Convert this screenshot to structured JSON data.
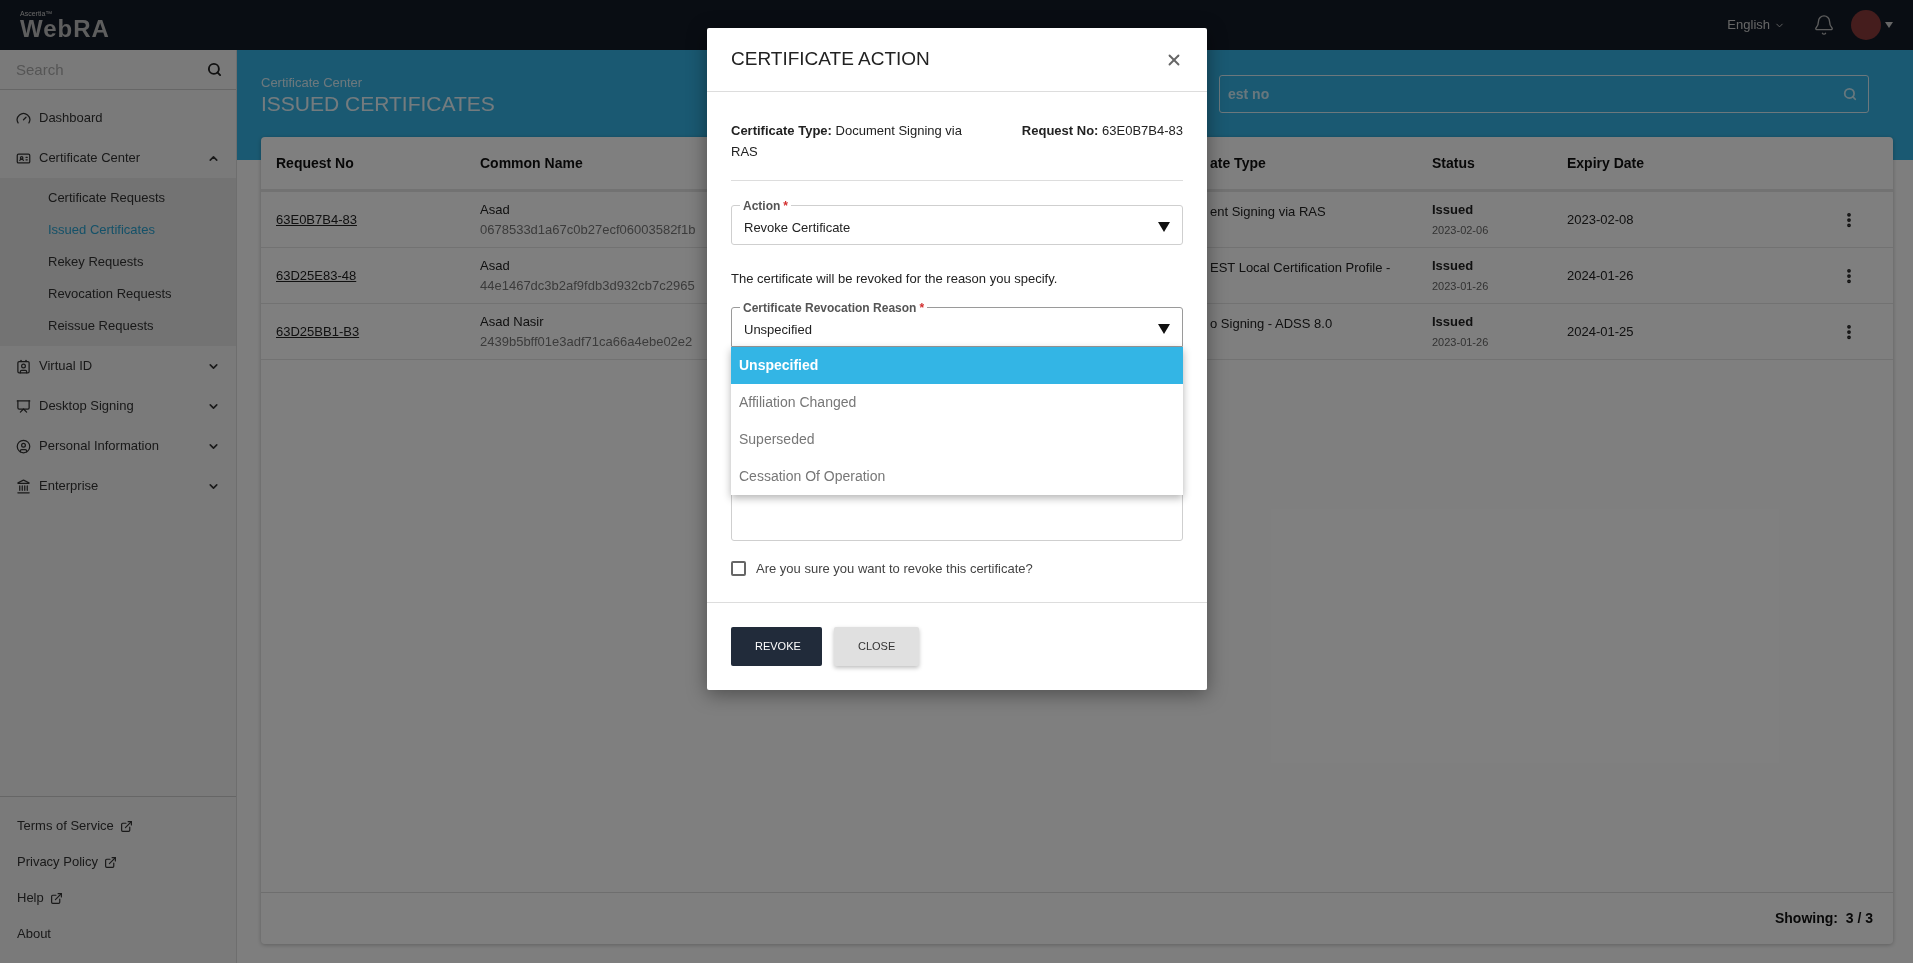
{
  "header": {
    "brand_small": "Ascertia™",
    "brand": "WebRA",
    "language": "English"
  },
  "sidebar": {
    "search": {
      "placeholder": "Search"
    },
    "items": [
      {
        "label": "Dashboard"
      },
      {
        "label": "Certificate Center",
        "expanded": true,
        "children": [
          {
            "label": "Certificate Requests",
            "selected": false
          },
          {
            "label": "Issued Certificates",
            "selected": true
          },
          {
            "label": "Rekey Requests",
            "selected": false
          },
          {
            "label": "Revocation Requests",
            "selected": false
          },
          {
            "label": "Reissue Requests",
            "selected": false
          }
        ]
      },
      {
        "label": "Virtual ID",
        "expanded": false
      },
      {
        "label": "Desktop Signing",
        "expanded": false
      },
      {
        "label": "Personal Information",
        "expanded": false
      },
      {
        "label": "Enterprise",
        "expanded": false
      }
    ],
    "footer_links": [
      {
        "label": "Terms of Service",
        "external": true
      },
      {
        "label": "Privacy Policy",
        "external": true
      },
      {
        "label": "Help",
        "external": true
      },
      {
        "label": "About",
        "external": false
      }
    ]
  },
  "banner": {
    "breadcrumb": "Certificate Center",
    "title": "ISSUED CERTIFICATES",
    "search": {
      "placeholder": "est no"
    }
  },
  "table": {
    "columns": [
      "Request No",
      "Common Name",
      "ate Type",
      "Status",
      "Expiry Date"
    ],
    "rows": [
      {
        "request_no": "63E0B7B4-83",
        "common_name": "Asad",
        "hash": "0678533d1a67c0b27ecf06003582f1b",
        "type": "ent Signing via RAS",
        "status": "Issued",
        "status_date": "2023-02-06",
        "expiry": "2023-02-08"
      },
      {
        "request_no": "63D25E83-48",
        "common_name": "Asad",
        "hash": "44e1467dc3b2af9fdb3d932cb7c2965",
        "type": "EST Local Certification Profile -",
        "status": "Issued",
        "status_date": "2023-01-26",
        "expiry": "2024-01-26"
      },
      {
        "request_no": "63D25BB1-B3",
        "common_name": "Asad Nasir",
        "hash": "2439b5bff01e3adf71ca66a4ebe02e2",
        "type": "o Signing - ADSS 8.0",
        "status": "Issued",
        "status_date": "2023-01-26",
        "expiry": "2024-01-25"
      }
    ],
    "footer": "Showing:  3 / 3"
  },
  "modal": {
    "title": "CERTIFICATE ACTION",
    "info": [
      {
        "label": "Certificate Type:",
        "value": "Document Signing via RAS"
      },
      {
        "label": "Request No:",
        "value": "63E0B7B4-83"
      }
    ],
    "action": {
      "label": "Action",
      "required_mark": "*",
      "value": "Revoke Certificate"
    },
    "note": "The certificate will be revoked for the reason you specify.",
    "reason": {
      "label": "Certificate Revocation Reason",
      "required_mark": "*",
      "value": "Unspecified",
      "expanded": true,
      "options": [
        {
          "label": "Unspecified",
          "selected": true
        },
        {
          "label": "Affiliation Changed",
          "selected": false
        },
        {
          "label": "Superseded",
          "selected": false
        },
        {
          "label": "Cessation Of Operation",
          "selected": false
        }
      ]
    },
    "confirm": {
      "label": "Are you sure you want to revoke this certificate?",
      "checked": false
    },
    "buttons": [
      {
        "label": "REVOKE",
        "kind": "primary"
      },
      {
        "label": "CLOSE",
        "kind": "secondary"
      }
    ]
  }
}
